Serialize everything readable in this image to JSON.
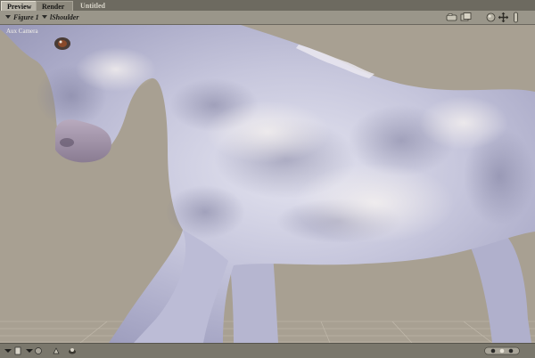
{
  "tabs": {
    "preview": "Preview",
    "render": "Render",
    "document": "Untitled"
  },
  "selectors": {
    "figure": "Figure 1",
    "body_part": "lShoulder"
  },
  "viewport": {
    "camera_label": "Aux Camera",
    "background_color": "#a8a092"
  },
  "icons": {
    "top_right": [
      "camera-controls-icon",
      "camera-views-icon",
      "rotate-trackball-icon",
      "move-xy-icon",
      "scale-icon"
    ],
    "bottom_left": [
      "display-style-icon",
      "document-style-icon",
      "render-options-icon",
      "figure-icon"
    ],
    "bottom_right": [
      "ground-plane-icon"
    ]
  }
}
